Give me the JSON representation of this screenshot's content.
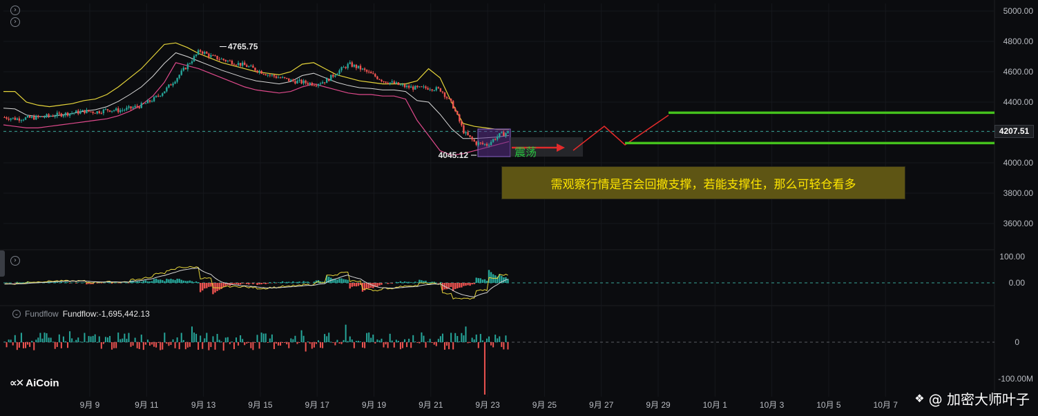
{
  "chart_data": [
    {
      "type": "candlestick",
      "title": "",
      "y_ticks": [
        "5000.00",
        "4800.00",
        "4600.00",
        "4400.00",
        "4200.00",
        "4000.00",
        "3800.00",
        "3600.00"
      ],
      "ylim": [
        3500,
        5050
      ],
      "x_ticks": [
        "9月 9",
        "9月 11",
        "9月 13",
        "9月 15",
        "9月 17",
        "9月 19",
        "9月 21",
        "9月 23",
        "9月 25",
        "9月 27",
        "9月 29",
        "10月 1",
        "10月 3",
        "10月 5",
        "10月 7"
      ],
      "current_price": "4207.51",
      "high_label": "4765.75",
      "low_label": "4045.12",
      "close_path": [
        4300,
        4290,
        4295,
        4300,
        4310,
        4320,
        4330,
        4340,
        4335,
        4350,
        4345,
        4360,
        4380,
        4420,
        4480,
        4560,
        4650,
        4740,
        4700,
        4680,
        4660,
        4640,
        4610,
        4580,
        4560,
        4540,
        4530,
        4520,
        4540,
        4600,
        4650,
        4620,
        4580,
        4540,
        4520,
        4500,
        4490,
        4495,
        4480,
        4380,
        4200,
        4130,
        4120,
        4180,
        4207.51
      ],
      "bands_upper": [
        4470,
        4470,
        4400,
        4380,
        4370,
        4380,
        4390,
        4410,
        4420,
        4450,
        4500,
        4560,
        4620,
        4700,
        4780,
        4790,
        4760,
        4720,
        4690,
        4660,
        4640,
        4620,
        4600,
        4590,
        4580,
        4600,
        4650,
        4660,
        4620,
        4580,
        4560,
        4540,
        4530,
        4520,
        4520,
        4520,
        4540,
        4620,
        4560,
        4400,
        4260,
        4240,
        4230,
        4220,
        4220
      ],
      "bands_lower": [
        4250,
        4240,
        4230,
        4230,
        4240,
        4250,
        4260,
        4270,
        4280,
        4290,
        4310,
        4340,
        4380,
        4440,
        4530,
        4660,
        4640,
        4620,
        4590,
        4560,
        4530,
        4500,
        4480,
        4470,
        4460,
        4470,
        4500,
        4520,
        4500,
        4480,
        4460,
        4450,
        4450,
        4440,
        4440,
        4420,
        4280,
        4180,
        4080,
        4050,
        4060,
        4080,
        4100,
        4120,
        4140
      ],
      "annotations": {
        "oscillation_label": "震荡",
        "note": "需观察行情是否会回撤支撑，若能支撑住，那么可轻仓看多"
      },
      "support_resistance": {
        "upper_green": 4330,
        "lower_green": 4130
      }
    },
    {
      "type": "macd",
      "y_ticks": [
        "100.00",
        "0.00"
      ],
      "ylim": [
        -120,
        120
      ]
    },
    {
      "type": "bar",
      "name": "Fundflow",
      "label": "Fundflow",
      "value_label": "Fundflow:-1,695,442.13",
      "y_ticks": [
        "0",
        "-100.00M"
      ]
    }
  ],
  "branding": {
    "logo_text": "AiCoin",
    "watermark": "@ 加密大师叶子"
  },
  "colors": {
    "background": "#0b0c0f",
    "up": "#26a69a",
    "down": "#ef5350",
    "upper_band": "#e6d53a",
    "lower_band": "#e04a8c",
    "mid_line": "#d9d9d9",
    "green_levels": "#45c21d",
    "projection": "#e22b2b",
    "note_bg": "#5e5514",
    "note_text": "#ffe600"
  },
  "icons": [
    "chevron-right-icon",
    "fundflow-toggle-icon",
    "diamond-icon"
  ]
}
